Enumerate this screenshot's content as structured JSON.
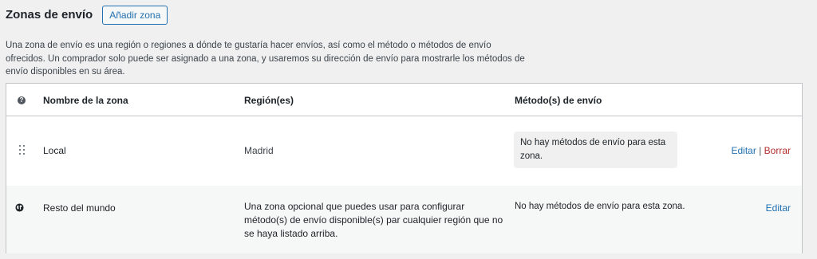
{
  "header": {
    "title": "Zonas de envío",
    "add_button": "Añadir zona"
  },
  "description": "Una zona de envío es una región o regiones a dónde te gustaría hacer envíos, así como el método o métodos de envío ofrecidos. Un comprador solo puede ser asignado a una zona, y usaremos su dirección de envío para mostrarle los métodos de envío disponibles en su área.",
  "table": {
    "help_icon_glyph": "?",
    "columns": {
      "name": "Nombre de la zona",
      "regions": "Región(es)",
      "methods": "Método(s) de envío"
    },
    "rows": [
      {
        "icon": "drag-handle-icon",
        "name": "Local",
        "region": "Madrid",
        "methods": "No hay métodos de envío para esta zona.",
        "edit": "Editar",
        "separator": "|",
        "delete": "Borrar"
      },
      {
        "icon": "globe-icon",
        "name": "Resto del mundo",
        "region": "Una zona opcional que puedes usar para configurar método(s) de envío disponible(s) par cualquier región que no se haya listado arriba.",
        "methods": "No hay métodos de envío para esta zona.",
        "edit": "Editar"
      }
    ]
  },
  "colors": {
    "accent": "#2271b1",
    "danger": "#b32d2e",
    "background": "#f0f0f1"
  }
}
